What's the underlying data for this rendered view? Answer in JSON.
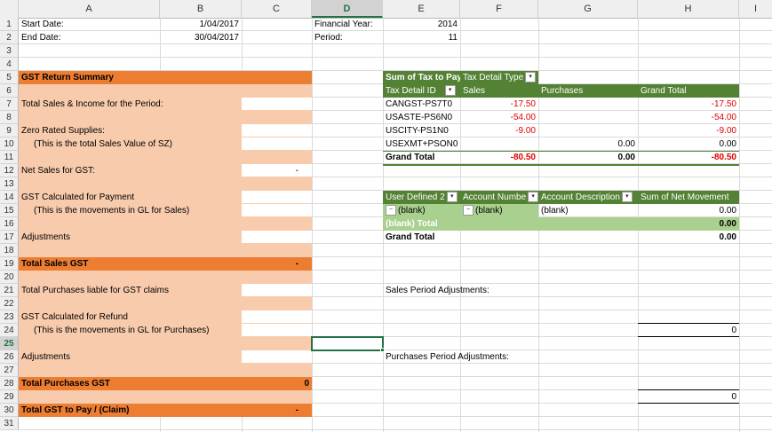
{
  "columns": [
    "A",
    "B",
    "C",
    "D",
    "E",
    "F",
    "G",
    "H",
    "I"
  ],
  "selected_column": "D",
  "selected_row": "25",
  "rows": [
    "1",
    "2",
    "3",
    "4",
    "5",
    "6",
    "7",
    "8",
    "9",
    "10",
    "11",
    "12",
    "13",
    "14",
    "15",
    "16",
    "17",
    "18",
    "19",
    "20",
    "21",
    "22",
    "23",
    "24",
    "25",
    "26",
    "27",
    "28",
    "29",
    "30",
    "31"
  ],
  "header_info": {
    "start_label": "Start Date:",
    "start_value": "1/04/2017",
    "end_label": "End Date:",
    "end_value": "30/04/2017",
    "fy_label": "Financial Year:",
    "fy_value": "2014",
    "period_label": "Period:",
    "period_value": "11"
  },
  "gst": {
    "title": "GST Return Summary",
    "total_sales": "Total Sales & Income for the Period:",
    "zero_rated": "Zero Rated Supplies:",
    "zero_rated_note": "(This is the total Sales Value of SZ)",
    "net_sales": "Net Sales for GST:",
    "net_sales_value": "-",
    "gst_calc_payment": "GST Calculated for Payment",
    "gst_calc_payment_note": "(This is the movements in GL for Sales)",
    "adjustments": "Adjustments",
    "total_sales_gst": "Total Sales GST",
    "total_sales_gst_value": "-",
    "total_purchases": "Total Purchases liable for GST claims",
    "gst_calc_refund": "GST Calculated for Refund",
    "gst_calc_refund_note": "(This is the movements in GL for Purchases)",
    "adjustments2": "Adjustments",
    "total_purchases_gst": "Total Purchases GST",
    "total_purchases_gst_value": "0",
    "total_gst": "Total GST to Pay / (Claim)",
    "total_gst_value": "-"
  },
  "pivot1": {
    "h1": "Sum of Tax to Pay",
    "h2": "Tax Detail Type",
    "c1": "Tax Detail ID",
    "c2": "Sales",
    "c3": "Purchases",
    "c4": "Grand Total",
    "rows": [
      {
        "id": "CANGST-PS7T0",
        "sales": "-17.50",
        "purchases": "",
        "total": "-17.50"
      },
      {
        "id": "USASTE-PS6N0",
        "sales": "-54.00",
        "purchases": "",
        "total": "-54.00"
      },
      {
        "id": "USCITY-PS1N0",
        "sales": "-9.00",
        "purchases": "",
        "total": "-9.00"
      },
      {
        "id": "USEXMT+PSON0",
        "sales": "",
        "purchases": "0.00",
        "total": "0.00"
      }
    ],
    "grand_label": "Grand Total",
    "grand_sales": "-80.50",
    "grand_purchases": "0.00",
    "grand_total": "-80.50"
  },
  "pivot2": {
    "h1": "User Defined 2",
    "h2": "Account Numbe",
    "h3": "Account Description",
    "h4": "Sum of Net Movement",
    "r1c1": "(blank)",
    "r1c2": "(blank)",
    "r1c3": "(blank)",
    "r1c4": "0.00",
    "subtotal_label": "(blank) Total",
    "subtotal_value": "0.00",
    "grand_label": "Grand Total",
    "grand_value": "0.00"
  },
  "sales_adj_label": "Sales Period Adjustments:",
  "sales_adj_value": "0",
  "purch_adj_label": "Purchases Period Adjustments:",
  "purch_adj_value": "0",
  "colors": {
    "orange": "#ed7d31",
    "peach": "#f8cbad",
    "green": "#548235",
    "light_green": "#a9d08e",
    "red": "#e00000",
    "excel_green": "#217346"
  }
}
